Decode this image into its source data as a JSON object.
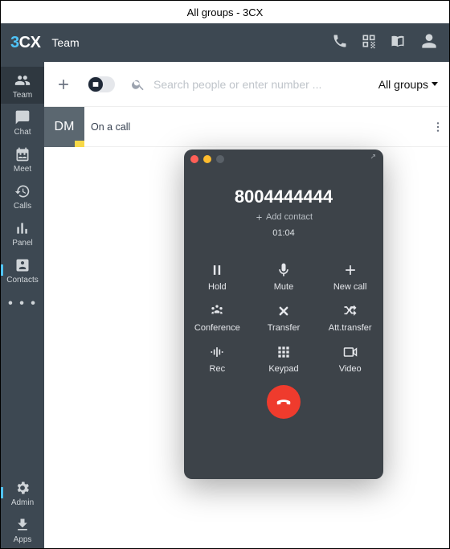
{
  "window": {
    "title": "All groups - 3CX"
  },
  "header": {
    "title": "Team"
  },
  "sidebar": {
    "items": [
      {
        "label": "Team"
      },
      {
        "label": "Chat"
      },
      {
        "label": "Meet"
      },
      {
        "label": "Calls"
      },
      {
        "label": "Panel"
      },
      {
        "label": "Contacts"
      }
    ],
    "more_label": "• • •",
    "bottom": [
      {
        "label": "Admin"
      },
      {
        "label": "Apps"
      }
    ]
  },
  "toolbar": {
    "search_placeholder": "Search people or enter number ...",
    "group_label": "All groups"
  },
  "list": {
    "rows": [
      {
        "initials": "DM",
        "status_text": "On a call"
      }
    ]
  },
  "call": {
    "number": "8004444444",
    "add_contact_label": "Add contact",
    "duration": "01:04",
    "actions": {
      "hold": "Hold",
      "mute": "Mute",
      "newcall": "New call",
      "conference": "Conference",
      "transfer": "Transfer",
      "att_transfer": "Att.transfer",
      "rec": "Rec",
      "keypad": "Keypad",
      "video": "Video"
    }
  }
}
